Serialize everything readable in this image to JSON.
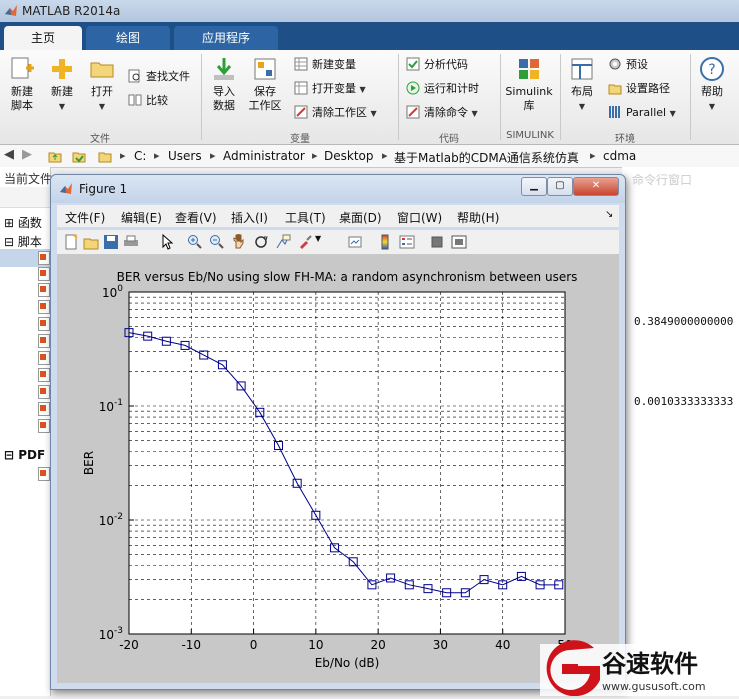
{
  "app": {
    "title": "MATLAB R2014a"
  },
  "ribbon_tabs": [
    {
      "label": "主页"
    },
    {
      "label": "绘图"
    },
    {
      "label": "应用程序"
    }
  ],
  "ribbon": {
    "file_group": {
      "label": "文件",
      "new_script": {
        "line1": "新建",
        "line2": "脚本"
      },
      "new": "新建",
      "open": "打开",
      "find_files": "查找文件",
      "compare": "比较"
    },
    "variable_group": {
      "label": "变量",
      "import": {
        "line1": "导入",
        "line2": "数据"
      },
      "save": {
        "line1": "保存",
        "line2": "工作区"
      },
      "new_variable": "新建变量",
      "open_variable": "打开变量",
      "clear_workspace": "清除工作区"
    },
    "code_group": {
      "label": "代码",
      "analyze": "分析代码",
      "run_time": "运行和计时",
      "clear_commands": "清除命令"
    },
    "simulink_group": {
      "label": "SIMULINK",
      "simulink": {
        "line1": "Simulink",
        "line2": "库"
      }
    },
    "env_group": {
      "label": "环境",
      "layout": "布局",
      "preferences": "预设",
      "set_path": "设置路径",
      "parallel": "Parallel"
    },
    "help": "帮助"
  },
  "address_bar": {
    "crumbs": [
      "C:",
      "Users",
      "Administrator",
      "Desktop",
      "基于Matlab的CDMA通信系统仿真",
      "cdma"
    ]
  },
  "left_panel": {
    "header": "当前文件",
    "functions": "函数",
    "scripts": "脚本",
    "pdf": "PDF"
  },
  "right_panel": {
    "header": "命令行窗口",
    "values": [
      "0.3849000000000",
      "0.0010333333333"
    ]
  },
  "figure_window": {
    "title": "Figure 1",
    "menu": [
      "文件(F)",
      "编辑(E)",
      "查看(V)",
      "插入(I)",
      "工具(T)",
      "桌面(D)",
      "窗口(W)",
      "帮助(H)"
    ]
  },
  "chart_data": {
    "type": "line",
    "title": "BER versus Eb/No using slow FH-MA: a random asynchronism between users",
    "xlabel": "Eb/No (dB)",
    "ylabel": "BER",
    "xlim": [
      -20,
      50
    ],
    "ylim": [
      0.001,
      1
    ],
    "yscale": "log",
    "x_ticks": [
      -20,
      -10,
      0,
      10,
      20,
      30,
      40,
      50
    ],
    "y_tick_labels": [
      {
        "base": "10",
        "exp": "0",
        "value": 1
      },
      {
        "base": "10",
        "exp": "-1",
        "value": 0.1
      },
      {
        "base": "10",
        "exp": "-2",
        "value": 0.01
      },
      {
        "base": "10",
        "exp": "-3",
        "value": 0.001
      }
    ],
    "grid": true,
    "marker": "square",
    "line_color": "#00008b",
    "series": [
      {
        "x": [
          -20,
          -17,
          -14,
          -11,
          -8,
          -5,
          -2,
          1,
          4,
          7,
          10,
          13,
          16,
          19,
          22,
          25,
          28,
          31,
          34,
          37,
          40,
          43,
          46,
          49
        ],
        "y": [
          0.44,
          0.41,
          0.37,
          0.34,
          0.28,
          0.23,
          0.15,
          0.088,
          0.045,
          0.021,
          0.011,
          0.0057,
          0.0043,
          0.0027,
          0.0031,
          0.0027,
          0.0025,
          0.0023,
          0.0023,
          0.003,
          0.0027,
          0.0032,
          0.0027,
          0.0027
        ]
      }
    ]
  },
  "watermark": {
    "brand": "谷速软件",
    "url": "www.gususoft.com"
  }
}
